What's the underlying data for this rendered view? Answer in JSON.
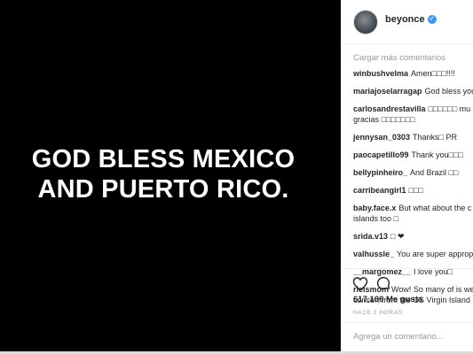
{
  "post": {
    "caption_line1": "GOD BLESS MEXICO",
    "caption_line2": "AND PUERTO RICO."
  },
  "header": {
    "username": "beyonce",
    "verified_icon": "verified-badge-icon",
    "verified_color": "#3897f0"
  },
  "load_more": "Cargar más comentarios",
  "comments": [
    {
      "user": "winbushvelma",
      "text": "Amen□□□!!!!",
      "line2": ""
    },
    {
      "user": "mariajoselarragap",
      "text": "God bless you",
      "line2": ""
    },
    {
      "user": "carlosandrestavilla",
      "text": "□□□□□□ mu",
      "line2": "gracias □□□□□□□"
    },
    {
      "user": "jennysan_0303",
      "text": "Thanks□ PR",
      "line2": ""
    },
    {
      "user": "paocapetillo99",
      "text": "Thank you□□□",
      "line2": ""
    },
    {
      "user": "bellypinheiro_",
      "text": "And Brazil □□",
      "line2": ""
    },
    {
      "user": "carribeangirl1",
      "text": "□□□",
      "line2": ""
    },
    {
      "user": "baby.face.x",
      "text": "But what about the c",
      "line2": "islands too □"
    },
    {
      "user": "srida.v13",
      "text": "□ ❤",
      "line2": ""
    },
    {
      "user": "valhussle_",
      "text": "You are super approp",
      "line2": ""
    },
    {
      "user": "__margomez__",
      "text": "I love you□",
      "line2": ""
    },
    {
      "user": "rielsmom",
      "text": "Wow! So many of is we",
      "line2": "concert from the US Virgin Island"
    }
  ],
  "actions": {
    "like_icon": "heart-icon",
    "comment_icon": "comment-icon"
  },
  "likes": "617.166 Me gusta",
  "time": "HACE 2 HORAS",
  "add_comment_placeholder": "Agrega un comentario..."
}
